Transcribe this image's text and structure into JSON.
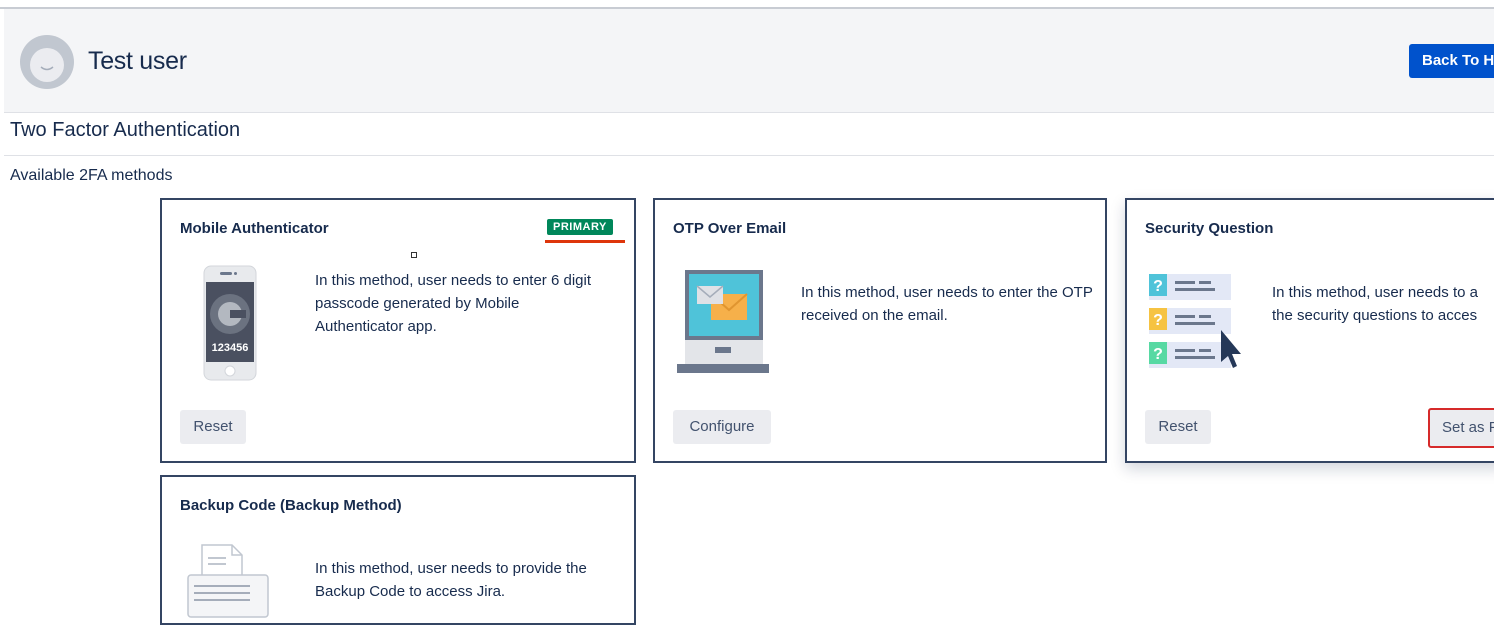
{
  "header": {
    "user_name": "Test user",
    "back_button": "Back To H"
  },
  "page_title": "Two Factor Authentication",
  "section_label": "Available 2FA methods",
  "colors": {
    "primary_badge": "#00875a",
    "back_button": "#0052cc",
    "highlight_red": "#d62a2a",
    "card_border": "#344563"
  },
  "methods": [
    {
      "title": "Mobile Authenticator",
      "badge": "PRIMARY",
      "description": "In this method, user needs to enter 6 digit passcode generated by Mobile Authenticator app.",
      "illustration_code": "123456",
      "icon": "mobile-phone-icon",
      "buttons": [
        "Reset"
      ]
    },
    {
      "title": "OTP Over Email",
      "description": "In this method, user needs to enter the OTP received on the email.",
      "icon": "laptop-email-icon",
      "buttons": [
        "Configure"
      ]
    },
    {
      "title": "Security Question",
      "description_line1": "In this method, user needs to a",
      "description_line2": "the security questions to acces",
      "icon": "security-question-icon",
      "buttons": [
        "Reset",
        "Set as P"
      ]
    },
    {
      "title": "Backup Code (Backup Method)",
      "description": "In this method, user needs to provide the Backup Code to access Jira.",
      "icon": "backup-code-document-icon",
      "buttons": []
    }
  ]
}
